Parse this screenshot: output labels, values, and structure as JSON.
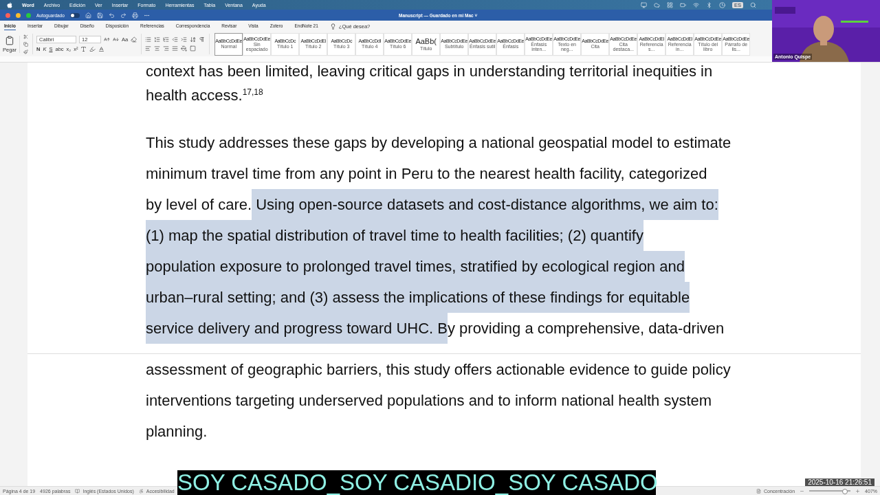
{
  "menu_bar": {
    "app": "Word",
    "items": [
      "Archivo",
      "Edición",
      "Ver",
      "Insertar",
      "Formato",
      "Herramientas",
      "Tabla",
      "Ventana",
      "Ayuda"
    ],
    "input_source": "ES"
  },
  "title_bar": {
    "autosave_label": "Autoguardado",
    "autosave_on": false,
    "title": "Manuscript — Guardado en mi Mac",
    "caret": "˅"
  },
  "ribbon_tabs": [
    {
      "label": "Inicio",
      "selected": true
    },
    {
      "label": "Insertar",
      "selected": false
    },
    {
      "label": "Dibujar",
      "selected": false
    },
    {
      "label": "Diseño",
      "selected": false
    },
    {
      "label": "Disposición",
      "selected": false
    },
    {
      "label": "Referencias",
      "selected": false
    },
    {
      "label": "Correspondencia",
      "selected": false
    },
    {
      "label": "Revisar",
      "selected": false
    },
    {
      "label": "Vista",
      "selected": false
    },
    {
      "label": "Zotero",
      "selected": false
    },
    {
      "label": "EndNote 21",
      "selected": false
    }
  ],
  "tell_me": "¿Qué desea?",
  "toolbar": {
    "paste_label": "Pegar",
    "font": "Calibri",
    "size": "12",
    "format_buttons": [
      "N",
      "K",
      "S",
      "abc",
      "x₂",
      "x²"
    ],
    "case_label": "Aa"
  },
  "styles": [
    {
      "sample": "AaBbCcDdEe",
      "name": "Normal",
      "selected": true
    },
    {
      "sample": "AaBbCcDdEe",
      "name": "Sin espaciado",
      "selected": false
    },
    {
      "sample": "AaBbCcDc",
      "name": "Título 1",
      "selected": false
    },
    {
      "sample": "AaBbCcDdEi",
      "name": "Título 2",
      "selected": false
    },
    {
      "sample": "AaBbCcDc",
      "name": "Título 3",
      "selected": false
    },
    {
      "sample": "AaBbCcDdI",
      "name": "Título 4",
      "selected": false
    },
    {
      "sample": "AaBbCcDdEe",
      "name": "Título 6",
      "selected": false
    },
    {
      "sample": "AaBb(",
      "name": "Título",
      "selected": false
    },
    {
      "sample": "AaBbCcDdEe",
      "name": "Subtítulo",
      "selected": false
    },
    {
      "sample": "AaBbCcDdEe",
      "name": "Énfasis sutil",
      "selected": false
    },
    {
      "sample": "AaBbCcDdEe",
      "name": "Énfasis",
      "selected": false
    },
    {
      "sample": "AaBbCcDdEe",
      "name": "Énfasis inten...",
      "selected": false
    },
    {
      "sample": "AaBbCcDdEe",
      "name": "Texto en neg...",
      "selected": false
    },
    {
      "sample": "AaBbCcDdEe",
      "name": "Cita",
      "selected": false
    },
    {
      "sample": "AaBbCcDdEe",
      "name": "Cita destaca...",
      "selected": false
    },
    {
      "sample": "AaBbCcDdEi",
      "name": "Referencia s...",
      "selected": false
    },
    {
      "sample": "AaBbCcDdEi",
      "name": "Referencia in...",
      "selected": false
    },
    {
      "sample": "AaBbCcDdEe",
      "name": "Título del libro",
      "selected": false
    },
    {
      "sample": "AaBbCcDdEe",
      "name": "Párrafo de lis...",
      "selected": false
    }
  ],
  "document": {
    "lines": [
      {
        "kind": "text",
        "segments": [
          {
            "text": "context has been limited, leaving critical gaps in understanding territorial inequities in",
            "selected": false
          }
        ]
      },
      {
        "kind": "text",
        "segments": [
          {
            "text": "health access.$^{17,18}$",
            "selected": false
          }
        ]
      },
      {
        "kind": "gap"
      },
      {
        "kind": "text",
        "segments": [
          {
            "text": "This study addresses these gaps by developing a national geospatial model to estimate",
            "selected": false
          }
        ]
      },
      {
        "kind": "text",
        "segments": [
          {
            "text": "minimum travel time from any point in Peru to the nearest health facility, categorized",
            "selected": false
          }
        ]
      },
      {
        "kind": "text",
        "segments": [
          {
            "text": "by level of care.",
            "selected": false
          },
          {
            "text": " Using open-source datasets and cost-distance algorithms, we aim to:",
            "selected": true
          }
        ]
      },
      {
        "kind": "text",
        "segments": [
          {
            "text": "(1) map the spatial distribution of travel time to health facilities; (2) quantify",
            "selected": true
          }
        ]
      },
      {
        "kind": "text",
        "segments": [
          {
            "text": "population exposure to prolonged travel times, stratified by ecological region and",
            "selected": true
          }
        ]
      },
      {
        "kind": "text",
        "segments": [
          {
            "text": "urban–rural setting; and (3) assess the implications of these findings for equitable",
            "selected": true
          }
        ]
      },
      {
        "kind": "text",
        "segments": [
          {
            "text": "service delivery and progress toward UHC. B",
            "selected": true
          },
          {
            "text": "y providing a comprehensive, data-driven",
            "selected": false
          }
        ]
      },
      {
        "kind": "page_break"
      },
      {
        "kind": "text",
        "segments": [
          {
            "text": "assessment of geographic barriers, this study offers actionable evidence to guide policy",
            "selected": false
          }
        ]
      },
      {
        "kind": "text",
        "segments": [
          {
            "text": "interventions targeting underserved populations and to inform national health system",
            "selected": false
          }
        ]
      },
      {
        "kind": "text",
        "segments": [
          {
            "text": "planning.",
            "selected": false
          }
        ]
      }
    ]
  },
  "status_bar": {
    "page": "Página 4 de 19",
    "words": "4926 palabras",
    "language": "Inglés (Estados Unidos)",
    "accessibility": "Accesibilidad",
    "focus": "Concentración",
    "zoom": {
      "level": 0.85,
      "reading": "407%"
    }
  },
  "video": {
    "name": "Antonio Quispe"
  },
  "subtitle": "SOY CASADO_SOY CASADIO_SOY CASADO",
  "timestamp": "2025-10-16 21:26:51"
}
